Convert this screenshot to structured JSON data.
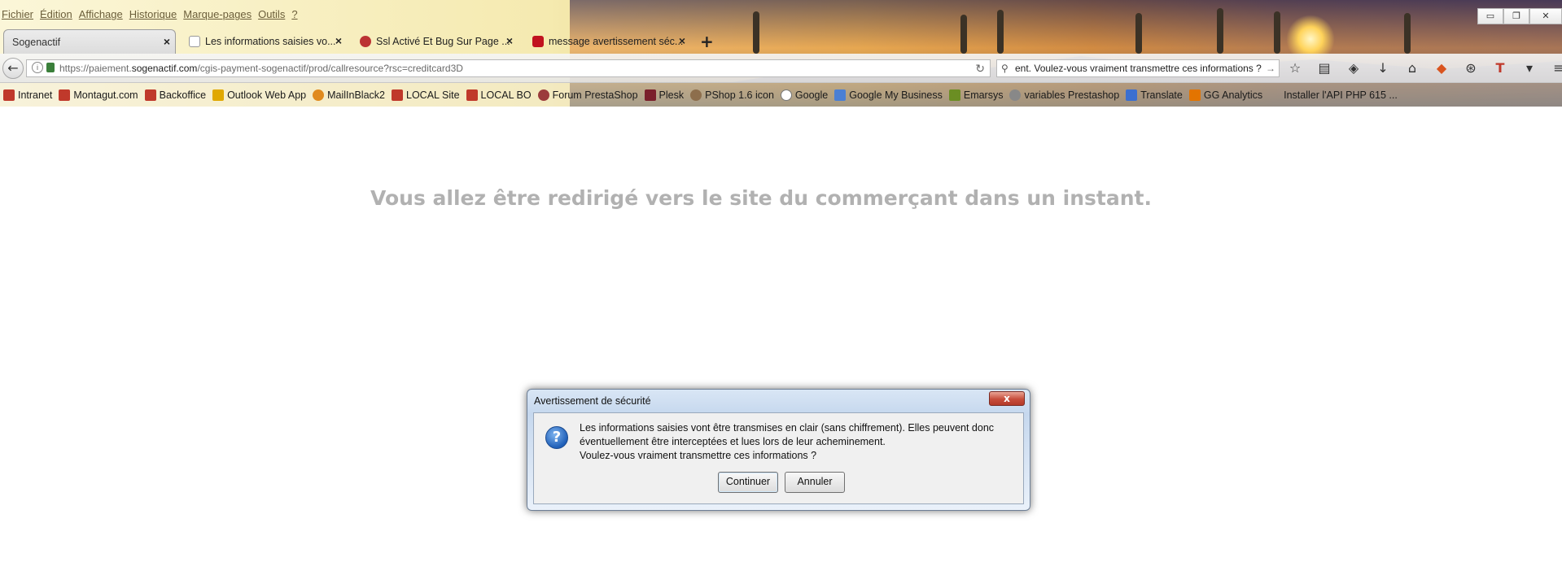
{
  "menu": [
    "Fichier",
    "Édition",
    "Affichage",
    "Historique",
    "Marque-pages",
    "Outils",
    "?"
  ],
  "window_controls": [
    "▭",
    "❐",
    "✕"
  ],
  "tabs": [
    {
      "label": "Sogenactif",
      "active": true
    },
    {
      "label": "Les informations saisies vo...",
      "active": false
    },
    {
      "label": "Ssl Activé Et Bug Sur Page ...",
      "active": false
    },
    {
      "label": "message avertissement séc...",
      "active": false
    }
  ],
  "new_tab_label": "+",
  "urlbar": {
    "scheme": "https://paiement.",
    "host": "sogenactif.com",
    "path": "/cgis-payment-sogenactif/prod/callresource?rsc=creditcard3D"
  },
  "searchbar": {
    "value": "ent. Voulez-vous vraiment transmettre ces informations ?"
  },
  "bookmarks": [
    "Intranet",
    "Montagut.com",
    "Backoffice",
    "Outlook Web App",
    "MailInBlack2",
    "LOCAL Site",
    "LOCAL BO",
    "Forum PrestaShop",
    "Plesk",
    "PShop 1.6 icon",
    "Google",
    "Google My Business",
    "Emarsys",
    "variables Prestashop",
    "Translate",
    "GG Analytics",
    "Installer l'API PHP 615 ..."
  ],
  "page": {
    "redirect_message": "Vous allez être redirigé vers le site du commerçant dans un instant."
  },
  "dialog": {
    "title": "Avertissement de sécurité",
    "close": "x",
    "icon": "question-icon",
    "message_line1": "Les informations saisies vont être transmises en clair (sans chiffrement). Elles peuvent donc",
    "message_line2": "éventuellement être interceptées et lues lors de leur acheminement.",
    "message_line3": "Voulez-vous vraiment transmettre ces informations ?",
    "continue_label": "Continuer",
    "cancel_label": "Annuler"
  },
  "colors": {
    "redirect_text": "#b1b1b1",
    "dialog_title_bg": "#c6d8ee",
    "close_button": "#c74d3b",
    "default_button_border": "#3c7fb1"
  }
}
